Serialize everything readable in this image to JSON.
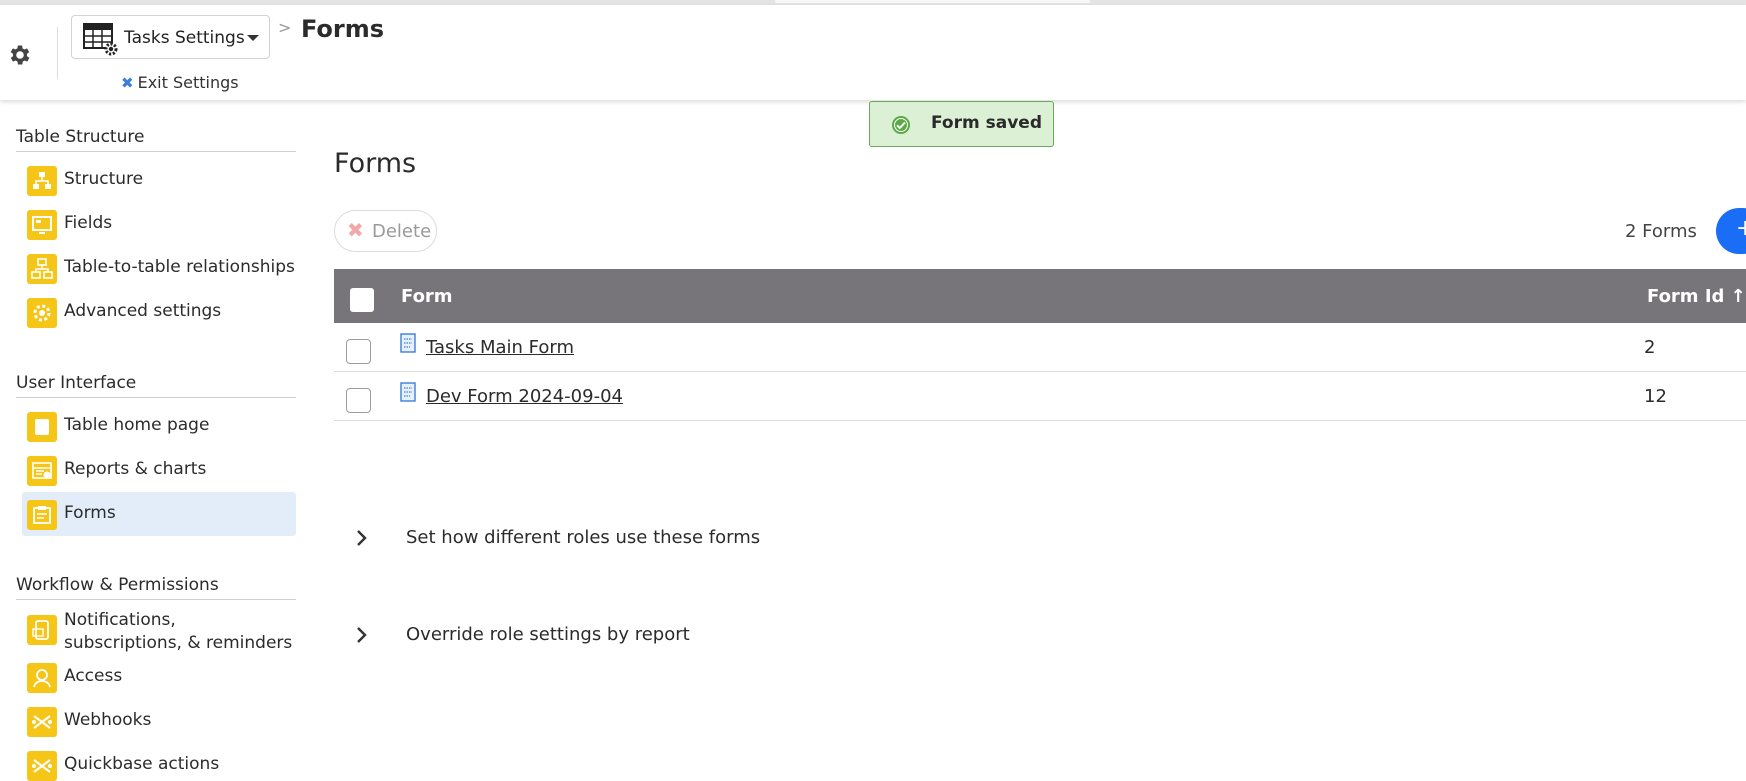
{
  "header": {
    "table_selector_label": "Tasks Settings",
    "breadcrumb_separator": ">",
    "breadcrumb_title": "Forms",
    "exit_label": "Exit Settings"
  },
  "toast": {
    "message": "Form saved"
  },
  "sidebar": {
    "sections": [
      {
        "title": "Table Structure"
      },
      {
        "title": "User Interface"
      },
      {
        "title": "Workflow & Permissions"
      }
    ],
    "items": [
      {
        "label": "Structure",
        "icon": "structure-icon"
      },
      {
        "label": "Fields",
        "icon": "fields-icon"
      },
      {
        "label": "Table-to-table relationships",
        "icon": "relationships-icon"
      },
      {
        "label": "Advanced settings",
        "icon": "gear-icon"
      },
      {
        "label": "Table home page",
        "icon": "home-page-icon"
      },
      {
        "label": "Reports & charts",
        "icon": "reports-icon"
      },
      {
        "label": "Forms",
        "icon": "forms-icon",
        "active": true
      },
      {
        "label": "Notifications, subscriptions, & reminders",
        "icon": "notifications-icon"
      },
      {
        "label": "Access",
        "icon": "access-icon"
      },
      {
        "label": "Webhooks",
        "icon": "webhooks-icon"
      },
      {
        "label": "Quickbase actions",
        "icon": "actions-icon"
      }
    ]
  },
  "main": {
    "title": "Forms",
    "delete_label": "Delete",
    "count_label": "2 Forms",
    "add_label": "+",
    "columns": {
      "form": "Form",
      "form_id": "Form Id ↑"
    },
    "rows": [
      {
        "name": "Tasks Main Form",
        "id": "2"
      },
      {
        "name": "Dev Form 2024-09-04",
        "id": "12"
      }
    ],
    "expanders": [
      {
        "label": "Set how different roles use these forms"
      },
      {
        "label": "Override role settings by report"
      }
    ]
  },
  "colors": {
    "accent": "#1a6ef5",
    "grid_header": "#777579",
    "sidebar_icon": "#f5c518",
    "toast_bg": "#dcf0d6",
    "active_nav": "#e3edf9"
  }
}
